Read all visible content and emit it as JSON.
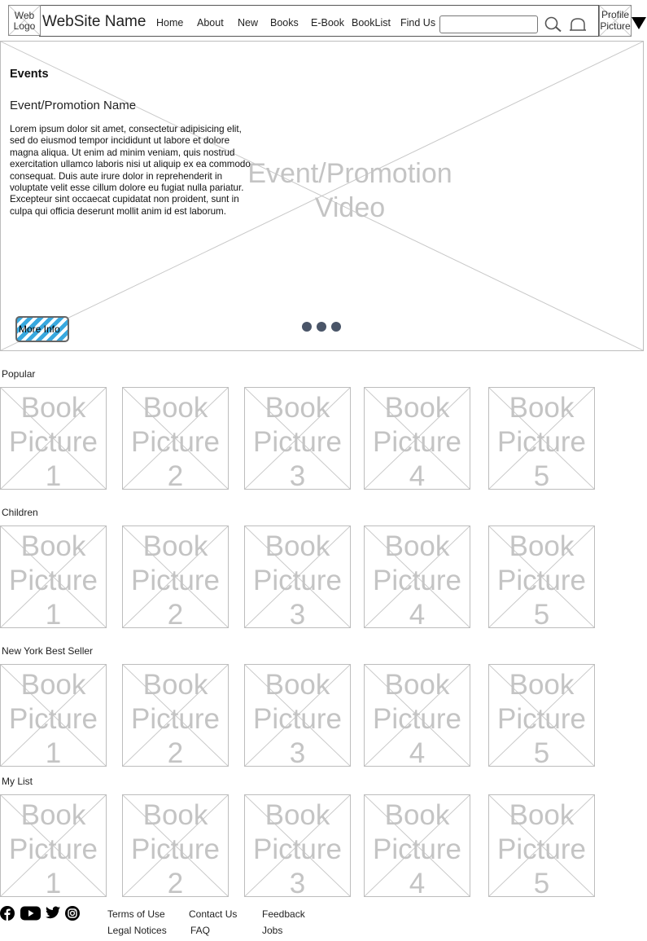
{
  "header": {
    "logo": [
      "Web",
      "Logo"
    ],
    "site_name": "WebSite Name",
    "nav": [
      "Home",
      "About",
      "New",
      "Books",
      "E-Book",
      "BookList",
      "Find Us"
    ],
    "search_value": "",
    "profile": [
      "Profile",
      "Picture"
    ]
  },
  "hero": {
    "section_title": "Events",
    "promo_name": "Event/Promotion Name",
    "description": "Lorem ipsum dolor sit amet, consectetur adipisicing elit, sed do eiusmod tempor incididunt ut labore et dolore magna aliqua. Ut enim ad minim veniam, quis nostrud exercitation ullamco laboris nisi ut aliquip ex ea commodo consequat. Duis aute irure dolor in reprehenderit in voluptate velit esse cillum dolore eu fugiat nulla pariatur. Excepteur sint occaecat cupidatat non proident, sunt in culpa qui officia deserunt mollit anim id est laborum.",
    "video_label": [
      "Event/Promotion",
      "Video"
    ],
    "more_info": "More Info",
    "carousel_dots": 3,
    "dot_color": "#4a5568"
  },
  "sections": [
    {
      "title": "Popular",
      "books": [
        [
          "Book",
          "Picture",
          "1"
        ],
        [
          "Book",
          "Picture",
          "2"
        ],
        [
          "Book",
          "Picture",
          "3"
        ],
        [
          "Book",
          "Picture",
          "4"
        ],
        [
          "Book",
          "Picture",
          "5"
        ]
      ]
    },
    {
      "title": "Children",
      "books": [
        [
          "Book",
          "Picture",
          "1"
        ],
        [
          "Book",
          "Picture",
          "2"
        ],
        [
          "Book",
          "Picture",
          "3"
        ],
        [
          "Book",
          "Picture",
          "4"
        ],
        [
          "Book",
          "Picture",
          "5"
        ]
      ]
    },
    {
      "title": "New York Best Seller",
      "books": [
        [
          "Book",
          "Picture",
          "1"
        ],
        [
          "Book",
          "Picture",
          "2"
        ],
        [
          "Book",
          "Picture",
          "3"
        ],
        [
          "Book",
          "Picture",
          "4"
        ],
        [
          "Book",
          "Picture",
          "5"
        ]
      ]
    },
    {
      "title": "My List",
      "books": [
        [
          "Book",
          "Picture",
          "1"
        ],
        [
          "Book",
          "Picture",
          "2"
        ],
        [
          "Book",
          "Picture",
          "3"
        ],
        [
          "Book",
          "Picture",
          "4"
        ],
        [
          "Book",
          "Picture",
          "5"
        ]
      ]
    }
  ],
  "footer": {
    "social_icons": [
      "facebook-icon",
      "youtube-icon",
      "twitter-icon",
      "instagram-icon"
    ],
    "links": [
      "Terms of Use",
      "Contact Us",
      "Feedback",
      "Legal Notices",
      "FAQ",
      "Jobs"
    ]
  },
  "colors": {
    "placeholder_text": "#c4c4c4",
    "placeholder_border": "#bdbdbd",
    "more_info_stripe": "#39a8de"
  }
}
